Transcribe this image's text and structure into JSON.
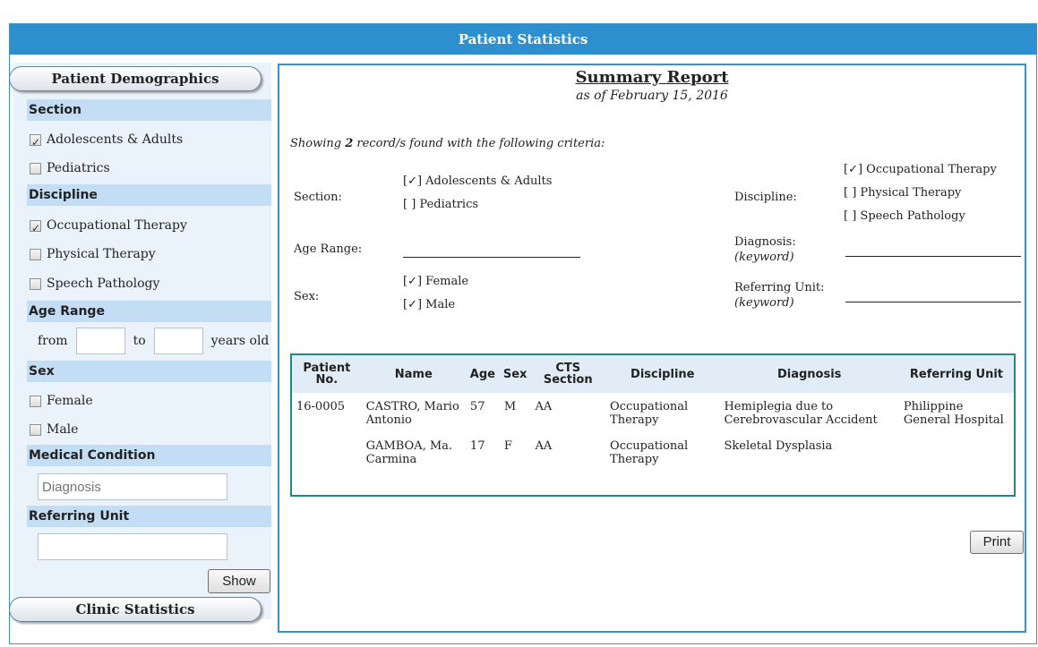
{
  "app": {
    "title": "Patient Statistics"
  },
  "sidebar": {
    "demographics_label": "Patient Demographics",
    "clinic_label": "Clinic Statistics",
    "section": {
      "heading": "Section",
      "options": [
        {
          "label": "Adolescents & Adults",
          "checked": true
        },
        {
          "label": "Pediatrics",
          "checked": false
        }
      ]
    },
    "discipline": {
      "heading": "Discipline",
      "options": [
        {
          "label": "Occupational Therapy",
          "checked": true
        },
        {
          "label": "Physical Therapy",
          "checked": false
        },
        {
          "label": "Speech Pathology",
          "checked": false
        }
      ]
    },
    "age_range": {
      "heading": "Age Range",
      "from_label": "from",
      "to_label": "to",
      "suffix": "years old",
      "from_value": "",
      "to_value": ""
    },
    "sex": {
      "heading": "Sex",
      "options": [
        {
          "label": "Female",
          "checked": false
        },
        {
          "label": "Male",
          "checked": false
        }
      ]
    },
    "medical": {
      "heading": "Medical Condition",
      "placeholder": "Diagnosis",
      "value": ""
    },
    "referring": {
      "heading": "Referring Unit",
      "value": ""
    },
    "show_label": "Show"
  },
  "report": {
    "title": "Summary Report",
    "subtitle": "as of February 15, 2016",
    "showing_prefix": "Showing ",
    "showing_count": "2",
    "showing_suffix": " record/s found with the following criteria:",
    "criteria": {
      "section_label": "Section:",
      "section_values": [
        "[✓] Adolescents & Adults",
        "[  ] Pediatrics"
      ],
      "discipline_label": "Discipline:",
      "discipline_values": [
        "[✓] Occupational Therapy",
        "[  ] Physical Therapy",
        "[  ] Speech Pathology"
      ],
      "age_label": "Age Range:",
      "diagnosis_label": "Diagnosis:",
      "diagnosis_hint": "(keyword)",
      "sex_label": "Sex:",
      "sex_values": [
        "[✓] Female",
        "[✓] Male"
      ],
      "referring_label": "Referring Unit:",
      "referring_hint": "(keyword)"
    },
    "table": {
      "headers": [
        "Patient No.",
        "Name",
        "Age",
        "Sex",
        "CTS Section",
        "Discipline",
        "Diagnosis",
        "Referring Unit"
      ],
      "rows": [
        [
          "16-0005",
          "CASTRO, Mario Antonio",
          "57",
          "M",
          "AA",
          "Occupational Therapy",
          "Hemiplegia due to Cerebrovascular Accident",
          "Philippine General Hospital"
        ],
        [
          "",
          "GAMBOA, Ma. Carmina",
          "17",
          "F",
          "AA",
          "Occupational Therapy",
          "Skeletal Dysplasia",
          ""
        ]
      ]
    },
    "print_label": "Print"
  }
}
